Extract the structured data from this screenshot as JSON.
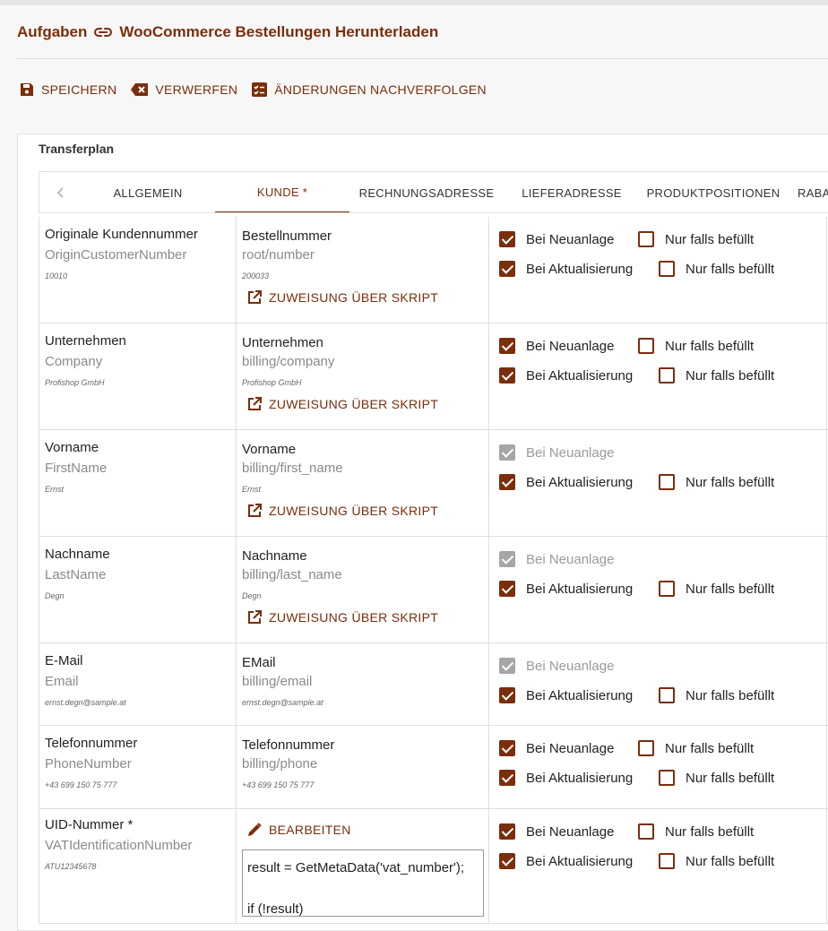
{
  "header": {
    "crumb_parent": "Aufgaben",
    "crumb_title": "WooCommerce Bestellungen Herunterladen"
  },
  "toolbar": {
    "save": "SPEICHERN",
    "discard": "VERWERFEN",
    "track": "ÄNDERUNGEN NACHVERFOLGEN"
  },
  "panel": {
    "title": "Transferplan"
  },
  "tabs": [
    "ALLGEMEIN",
    "KUNDE *",
    "RECHNUNGSADRESSE",
    "LIEFERADRESSE",
    "PRODUKTPOSITIONEN",
    "RABA"
  ],
  "labels": {
    "script_btn": "ZUWEISUNG ÜBER SKRIPT",
    "edit_btn": "BEARBEITEN",
    "on_create": "Bei Neuanlage",
    "on_update": "Bei Aktualisierung",
    "only_if_filled": "Nur falls befüllt"
  },
  "rows": [
    {
      "target_label": "Originale Kundennummer",
      "target_field": "OriginCustomerNumber",
      "target_example": "10010",
      "source_label": "Bestellnummer",
      "source_path": "root/number",
      "source_example": "200033"
    },
    {
      "target_label": "Unternehmen",
      "target_field": "Company",
      "target_example": "Profishop GmbH",
      "source_label": "Unternehmen",
      "source_path": "billing/company",
      "source_example": "Profishop GmbH"
    },
    {
      "target_label": "Vorname",
      "target_field": "FirstName",
      "target_example": "Ernst",
      "source_label": "Vorname",
      "source_path": "billing/first_name",
      "source_example": "Ernst"
    },
    {
      "target_label": "Nachname",
      "target_field": "LastName",
      "target_example": "Degn",
      "source_label": "Nachname",
      "source_path": "billing/last_name",
      "source_example": "Degn"
    },
    {
      "target_label": "E-Mail",
      "target_field": "Email",
      "target_example": "ernst.degn@sample.at",
      "source_label": "EMail",
      "source_path": "billing/email",
      "source_example": "ernst.degn@sample.at"
    },
    {
      "target_label": "Telefonnummer",
      "target_field": "PhoneNumber",
      "target_example": "+43 699 150 75 777",
      "source_label": "Telefonnummer",
      "source_path": "billing/phone",
      "source_example": "+43 699 150 75 777"
    },
    {
      "target_label": "UID-Nummer *",
      "target_field": "VATIdentificationNumber",
      "target_example": "ATU12345678",
      "script_line1": "result = GetMetaData('vat_number');",
      "script_line2": "if (!result)"
    }
  ],
  "colors": {
    "accent": "#7a2e0b",
    "disabled": "#a6a6a6"
  }
}
